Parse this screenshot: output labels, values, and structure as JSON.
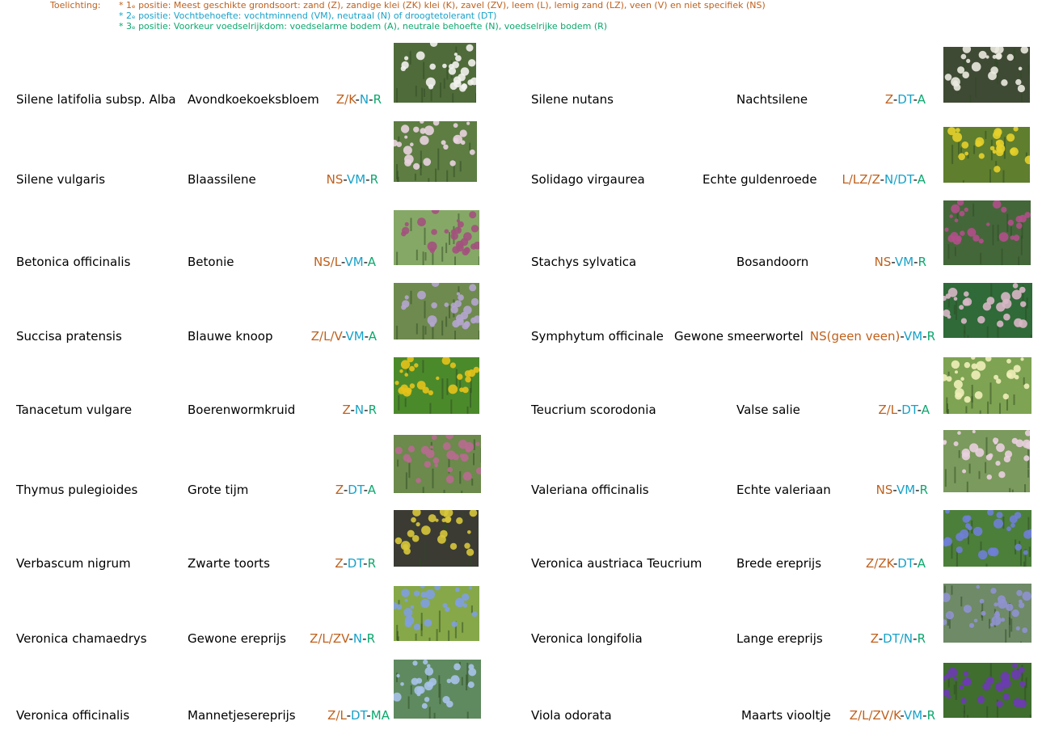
{
  "legend": {
    "label": "Toelichting:",
    "line1": "* 1ₑ positie: Meest geschikte grondsoort: zand (Z), zandige klei (ZK) klei (K), zavel (ZV), leem (L), lemig zand (LZ), veen (V) en niet specifiek (NS)",
    "line2": "* 2ₑ positie: Vochtbehoefte: vochtminnend (VM), neutraal (N) of droogtetolerant (DT)",
    "line3": "* 3ₑ positie: Voorkeur voedselrijkdom: voedselarme bodem (A), neutrale behoefte (N), voedselrijke bodem (R)"
  },
  "colors": {
    "position1": "#c0601c",
    "position2": "#17a2c9",
    "position3": "#0aa86e"
  },
  "left": [
    {
      "latin": "Silene latifolia subsp. Alba",
      "dutch": "Avondkoekoeksbloem",
      "code": [
        [
          "Z/K",
          "c1"
        ],
        [
          "-",
          ""
        ],
        [
          "N",
          "c2"
        ],
        [
          "-",
          ""
        ],
        [
          "R",
          "c3"
        ]
      ],
      "photo": "white-flowers-photo"
    },
    {
      "latin": "Silene vulgaris",
      "dutch": "Blaassilene",
      "code": [
        [
          "NS",
          "c1"
        ],
        [
          "-",
          ""
        ],
        [
          "VM",
          "c2"
        ],
        [
          "-",
          ""
        ],
        [
          "R",
          "c3"
        ]
      ],
      "photo": "pink-white-flowers-photo"
    },
    {
      "latin": "Betonica officinalis",
      "dutch": "Betonie",
      "code": [
        [
          "NS/L",
          "c1"
        ],
        [
          "-",
          ""
        ],
        [
          "VM",
          "c2"
        ],
        [
          "-",
          ""
        ],
        [
          "A",
          "c3"
        ]
      ],
      "photo": "purple-spikes-photo"
    },
    {
      "latin": "Succisa pratensis",
      "dutch": "Blauwe knoop",
      "code": [
        [
          "Z/L/V",
          "c1"
        ],
        [
          "-",
          ""
        ],
        [
          "VM",
          "c2"
        ],
        [
          "-",
          ""
        ],
        [
          "A",
          "c3"
        ]
      ],
      "photo": "lilac-buttons-photo"
    },
    {
      "latin": "Tanacetum vulgare",
      "dutch": "Boerenwormkruid",
      "code": [
        [
          "Z",
          "c1"
        ],
        [
          "-",
          ""
        ],
        [
          "N",
          "c2"
        ],
        [
          "-",
          ""
        ],
        [
          "R",
          "c3"
        ]
      ],
      "photo": "yellow-buttons-photo"
    },
    {
      "latin": "Thymus pulegioides",
      "dutch": "Grote tijm",
      "code": [
        [
          "Z",
          "c1"
        ],
        [
          "-",
          ""
        ],
        [
          "DT",
          "c2"
        ],
        [
          "-",
          ""
        ],
        [
          "A",
          "c3"
        ]
      ],
      "photo": "thyme-photo"
    },
    {
      "latin": "Verbascum nigrum",
      "dutch": "Zwarte toorts",
      "code": [
        [
          "Z",
          "c1"
        ],
        [
          "-",
          ""
        ],
        [
          "DT",
          "c2"
        ],
        [
          "-",
          ""
        ],
        [
          "R",
          "c3"
        ]
      ],
      "photo": "yellow-spikes-fence-photo"
    },
    {
      "latin": "Veronica chamaedrys",
      "dutch": "Gewone ereprijs",
      "code": [
        [
          "Z/L/ZV",
          "c1"
        ],
        [
          "-",
          ""
        ],
        [
          "N",
          "c2"
        ],
        [
          "-",
          ""
        ],
        [
          "R",
          "c3"
        ]
      ],
      "photo": "small-blue-flowers-photo"
    },
    {
      "latin": "Veronica officinalis",
      "dutch": "Mannetjesereprijs",
      "code": [
        [
          "Z/L",
          "c1"
        ],
        [
          "-",
          ""
        ],
        [
          "DT",
          "c2"
        ],
        [
          "-",
          ""
        ],
        [
          "MA",
          "c3"
        ]
      ],
      "photo": "pale-blue-flowers-photo"
    }
  ],
  "right": [
    {
      "latin": "Silene nutans",
      "dutch": "Nachtsilene",
      "code": [
        [
          "Z",
          "c1"
        ],
        [
          "-",
          ""
        ],
        [
          "DT",
          "c2"
        ],
        [
          "-",
          ""
        ],
        [
          "A",
          "c3"
        ]
      ],
      "photo": "white-flowers-rocky-photo"
    },
    {
      "latin": "Solidago virgaurea",
      "dutch": "Echte guldenroede",
      "code": [
        [
          "L/LZ/Z",
          "c1"
        ],
        [
          "-",
          ""
        ],
        [
          "N/DT",
          "c2"
        ],
        [
          "-",
          ""
        ],
        [
          "A",
          "c3"
        ]
      ],
      "photo": "goldenrod-photo"
    },
    {
      "latin": "Stachys sylvatica",
      "dutch": "Bosandoorn",
      "code": [
        [
          "NS",
          "c1"
        ],
        [
          "-",
          ""
        ],
        [
          "VM",
          "c2"
        ],
        [
          "-",
          ""
        ],
        [
          "R",
          "c3"
        ]
      ],
      "photo": "magenta-spikes-photo"
    },
    {
      "latin": "Symphytum officinale",
      "dutch": "Gewone smeerwortel",
      "code": [
        [
          "NS(geen veen)",
          "c1"
        ],
        [
          "-",
          ""
        ],
        [
          "VM",
          "c2"
        ],
        [
          "-",
          ""
        ],
        [
          "R",
          "c3"
        ]
      ],
      "photo": "comfrey-photo"
    },
    {
      "latin": "Teucrium scorodonia",
      "dutch": "Valse salie",
      "code": [
        [
          "Z/L",
          "c1"
        ],
        [
          "-",
          ""
        ],
        [
          "DT",
          "c2"
        ],
        [
          "-",
          ""
        ],
        [
          "A",
          "c3"
        ]
      ],
      "photo": "pale-yellow-spikes-photo"
    },
    {
      "latin": "Valeriana officinalis",
      "dutch": "Echte valeriaan",
      "code": [
        [
          "NS",
          "c1"
        ],
        [
          "-",
          ""
        ],
        [
          "VM",
          "c2"
        ],
        [
          "-",
          ""
        ],
        [
          "R",
          "c3"
        ]
      ],
      "photo": "pale-pink-umbels-photo"
    },
    {
      "latin": "Veronica austriaca Teucrium",
      "dutch": "Brede ereprijs",
      "code": [
        [
          "Z/ZK",
          "c1"
        ],
        [
          "-",
          ""
        ],
        [
          "DT",
          "c2"
        ],
        [
          "-",
          ""
        ],
        [
          "A",
          "c3"
        ]
      ],
      "photo": "blue-spikes-photo"
    },
    {
      "latin": "Veronica longifolia",
      "dutch": "Lange ereprijs",
      "code": [
        [
          "Z",
          "c1"
        ],
        [
          "-",
          ""
        ],
        [
          "DT/N",
          "c2"
        ],
        [
          "-",
          ""
        ],
        [
          "R",
          "c3"
        ]
      ],
      "photo": "lavender-spikes-photo"
    },
    {
      "latin": "Viola odorata",
      "dutch": "Maarts viooltje",
      "code": [
        [
          "Z/L/ZV/K",
          "c1"
        ],
        [
          "-",
          ""
        ],
        [
          "VM",
          "c2"
        ],
        [
          "-",
          ""
        ],
        [
          "R",
          "c3"
        ]
      ],
      "photo": "violets-photo"
    }
  ]
}
